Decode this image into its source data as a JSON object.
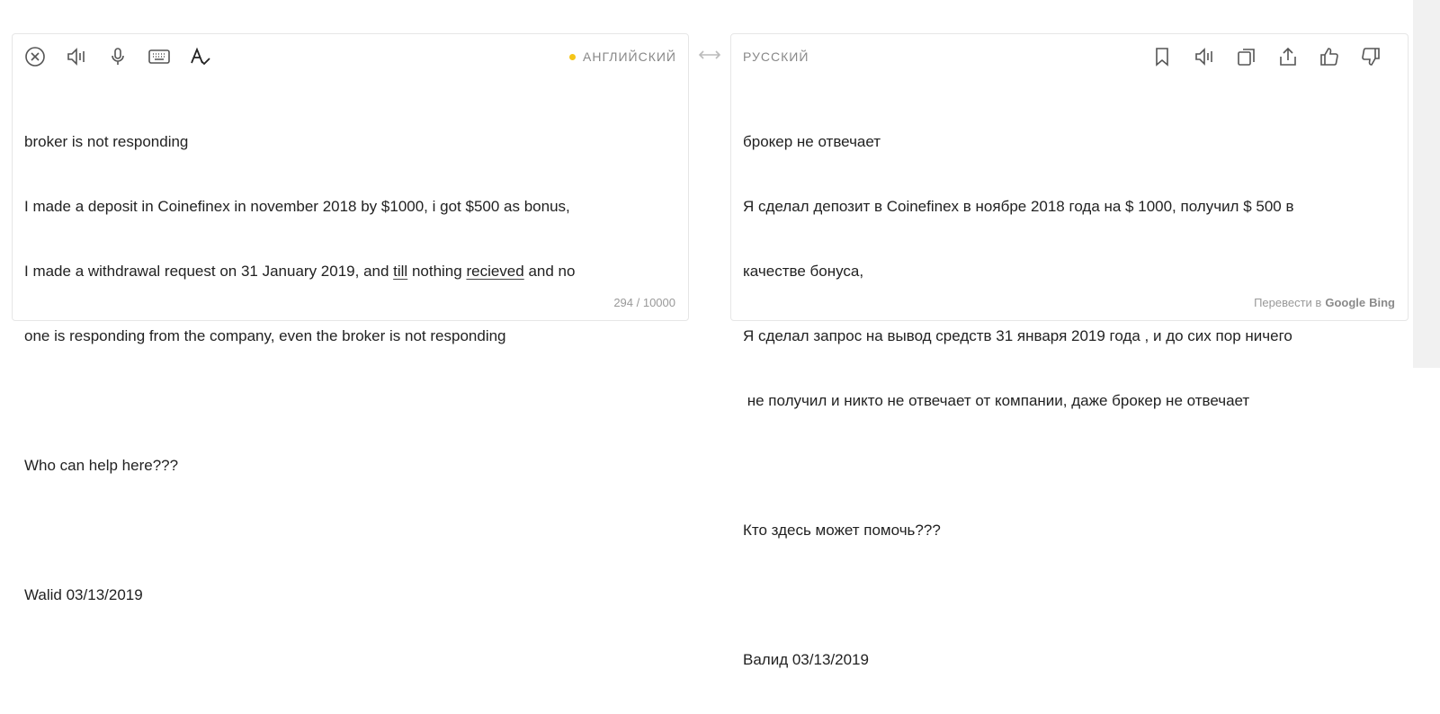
{
  "source": {
    "language": "АНГЛИЙСКИЙ",
    "lines": [
      "broker is not responding",
      "I made a deposit in Coinefinex in november 2018 by $1000, i got $500 as bonus,",
      "",
      "",
      "",
      "Who can help here???",
      "",
      "Walid 03/13/2019"
    ],
    "line3_a": "I made a withdrawal request on 31 January 2019, and ",
    "line3_till": "till",
    "line3_b": " nothing ",
    "line3_recieved": "recieved",
    "line3_c": " and no",
    "line4": "one is responding from the company, even the broker is not responding",
    "char_count": "294 / 10000",
    "icons": [
      "close-icon",
      "speaker-icon",
      "microphone-icon",
      "keyboard-icon",
      "spellcheck-icon"
    ]
  },
  "target": {
    "language": "РУССКИЙ",
    "lines": [
      "брокер не отвечает",
      "Я сделал депозит в Coinefinex в ноябре 2018 года на $ 1000, получил $ 500 в",
      "качестве бонуса,",
      "Я сделал запрос на вывод средств 31 января 2019 года , и до сих пор ничего",
      " не получил и никто не отвечает от компании, даже брокер не отвечает",
      "",
      "Кто здесь может помочь???",
      "",
      "Валид 03/13/2019"
    ],
    "footer_label": "Перевести в",
    "engines": [
      "Google",
      "Bing"
    ],
    "icons": [
      "bookmark-icon",
      "speaker-icon",
      "copy-icon",
      "share-icon",
      "thumbs-up-icon",
      "thumbs-down-icon"
    ]
  },
  "colors": {
    "lang_dot": "#f5c518",
    "icon": "#555555",
    "muted": "#999999"
  },
  "swap_icon": "swap-arrows-icon"
}
